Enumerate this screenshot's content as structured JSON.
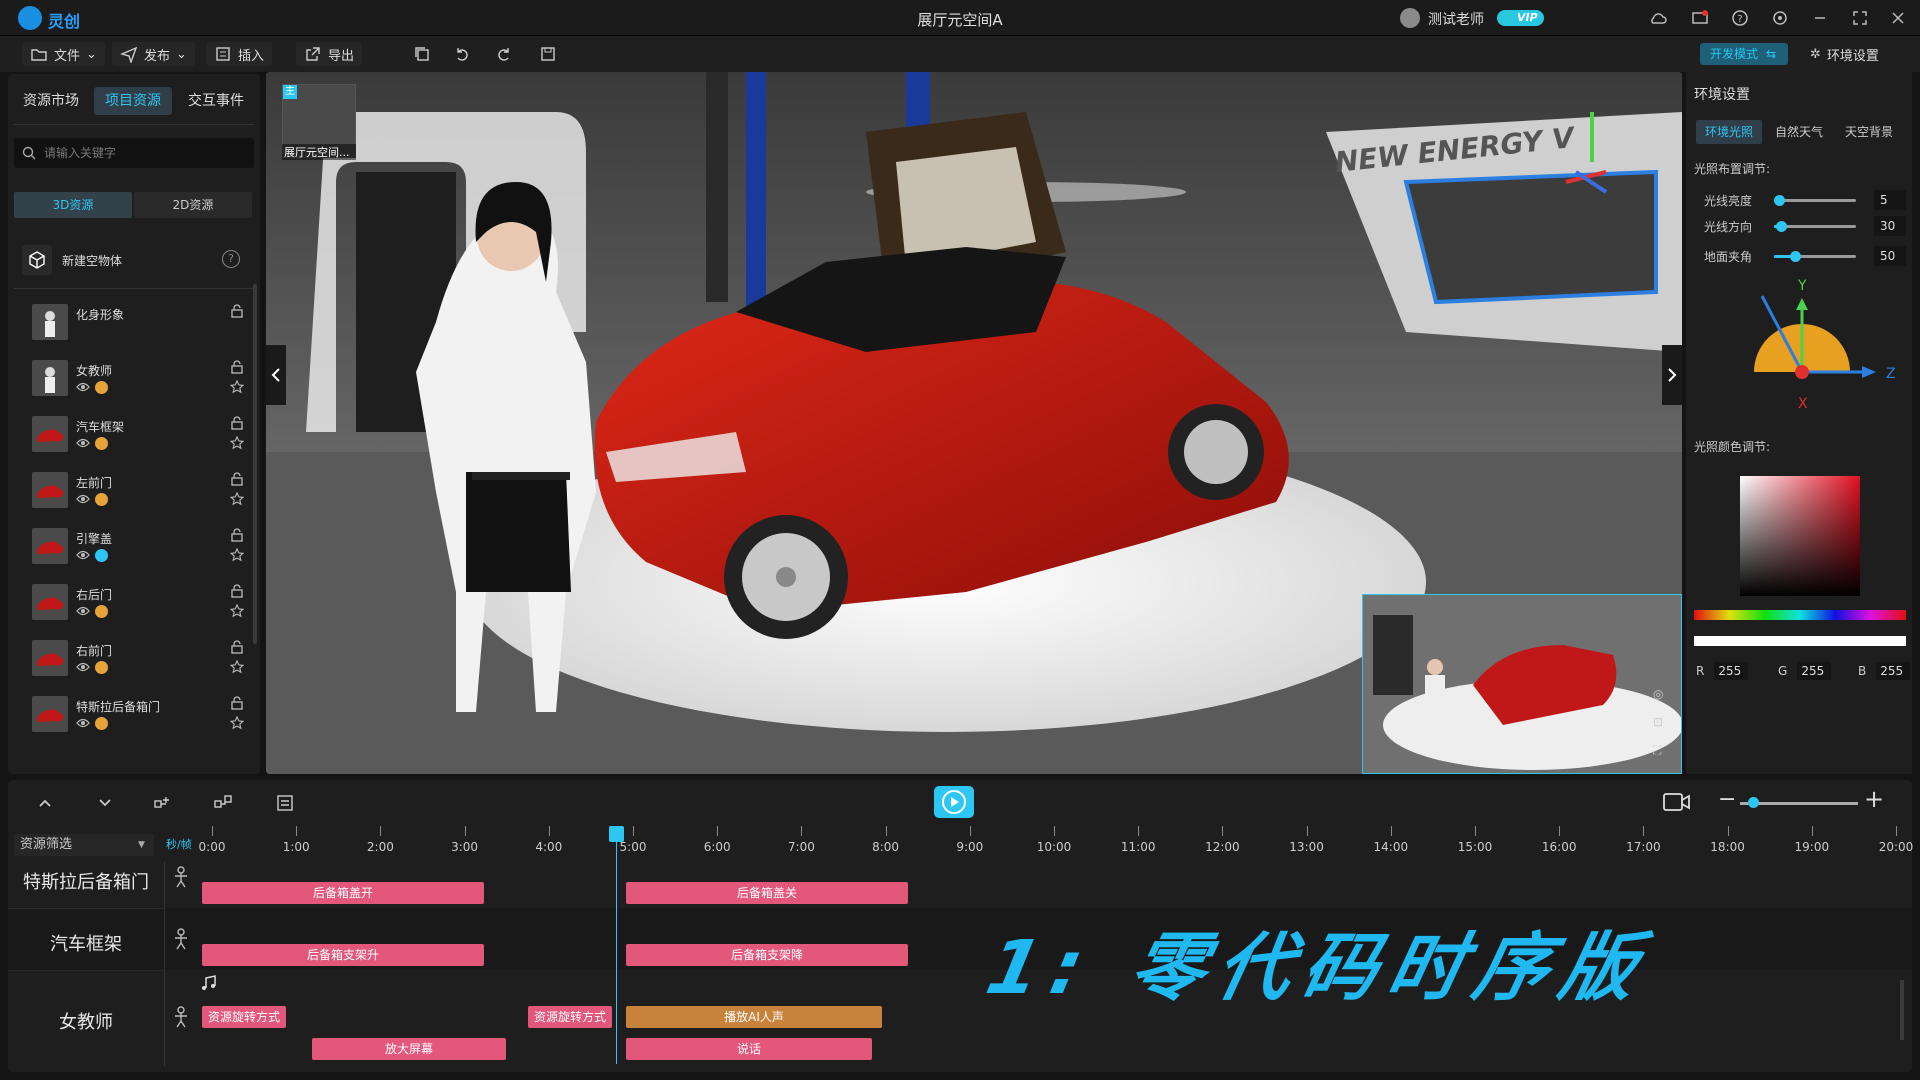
{
  "window": {
    "app_name": "灵创",
    "title": "展厅元空间A",
    "user_name": "测试老师",
    "vip_label": "VIP"
  },
  "toolbar": {
    "file": "文件",
    "publish": "发布",
    "insert": "插入",
    "export": "导出",
    "dev_mode": "开发模式",
    "env_settings": "环境设置"
  },
  "left_panel": {
    "tabs": [
      "资源市场",
      "项目资源",
      "交互事件"
    ],
    "active_tab": "项目资源",
    "search_placeholder": "请输入关键字",
    "subtabs": [
      "3D资源",
      "2D资源"
    ],
    "new_object": "新建空物体",
    "objects": [
      {
        "name": "化身形象",
        "has_status": false,
        "status": ""
      },
      {
        "name": "女教师",
        "has_status": true,
        "status": "orange"
      },
      {
        "name": "汽车框架",
        "has_status": true,
        "status": "orange"
      },
      {
        "name": "左前门",
        "has_status": true,
        "status": "orange"
      },
      {
        "name": "引擎盖",
        "has_status": true,
        "status": "cyan"
      },
      {
        "name": "右后门",
        "has_status": true,
        "status": "orange"
      },
      {
        "name": "右前门",
        "has_status": true,
        "status": "orange"
      },
      {
        "name": "特斯拉后备箱门",
        "has_status": true,
        "status": "orange"
      }
    ]
  },
  "viewport": {
    "scene_thumb_label": "展厅元空间...",
    "scene_badge": "主",
    "banner_text": "NEW ENERGY V",
    "overlay_text": "1: 零代码时序版"
  },
  "right_panel": {
    "title": "环境设置",
    "tabs": [
      "环境光照",
      "自然天气",
      "天空背景"
    ],
    "active_tab": "环境光照",
    "light_section": "光照布置调节:",
    "sliders": [
      {
        "label": "光线亮度",
        "value": 5,
        "fraction": 0.06
      },
      {
        "label": "光线方向",
        "value": 30,
        "fraction": 0.08
      },
      {
        "label": "地面夹角",
        "value": 50,
        "fraction": 0.26
      }
    ],
    "axis_labels": {
      "y": "Y",
      "x": "X",
      "z": "Z"
    },
    "color_section": "光照颜色调节:",
    "rgb": {
      "r_label": "R",
      "r": "255",
      "g_label": "G",
      "g": "255",
      "b_label": "B",
      "b": "255"
    }
  },
  "timeline": {
    "filter_label": "资源筛选",
    "fps_label": "秒/帧",
    "ticks": [
      "0:00",
      "1:00",
      "2:00",
      "3:00",
      "4:00",
      "5:00",
      "6:00",
      "7:00",
      "8:00",
      "9:00",
      "10:00",
      "11:00",
      "12:00",
      "13:00",
      "14:00",
      "15:00",
      "16:00",
      "17:00",
      "18:00",
      "19:00",
      "20:00"
    ],
    "playhead_time": "5:00",
    "tracks": [
      {
        "name": "特斯拉后备箱门"
      },
      {
        "name": "汽车框架"
      },
      {
        "name": "女教师"
      }
    ],
    "clips": {
      "trunk_open": "后备箱盖开",
      "trunk_close": "后备箱盖关",
      "support_up": "后备箱支架升",
      "support_down": "后备箱支架降",
      "rotate1": "资源旋转方式",
      "rotate2": "资源旋转方式",
      "ai_voice": "播放AI人声",
      "zoom_screen": "放大屏幕",
      "speak": "说话"
    }
  },
  "colors": {
    "accent": "#2ec6f2",
    "clip_pink": "#e3577b",
    "clip_orange": "#c9823a",
    "background": "#141414"
  }
}
